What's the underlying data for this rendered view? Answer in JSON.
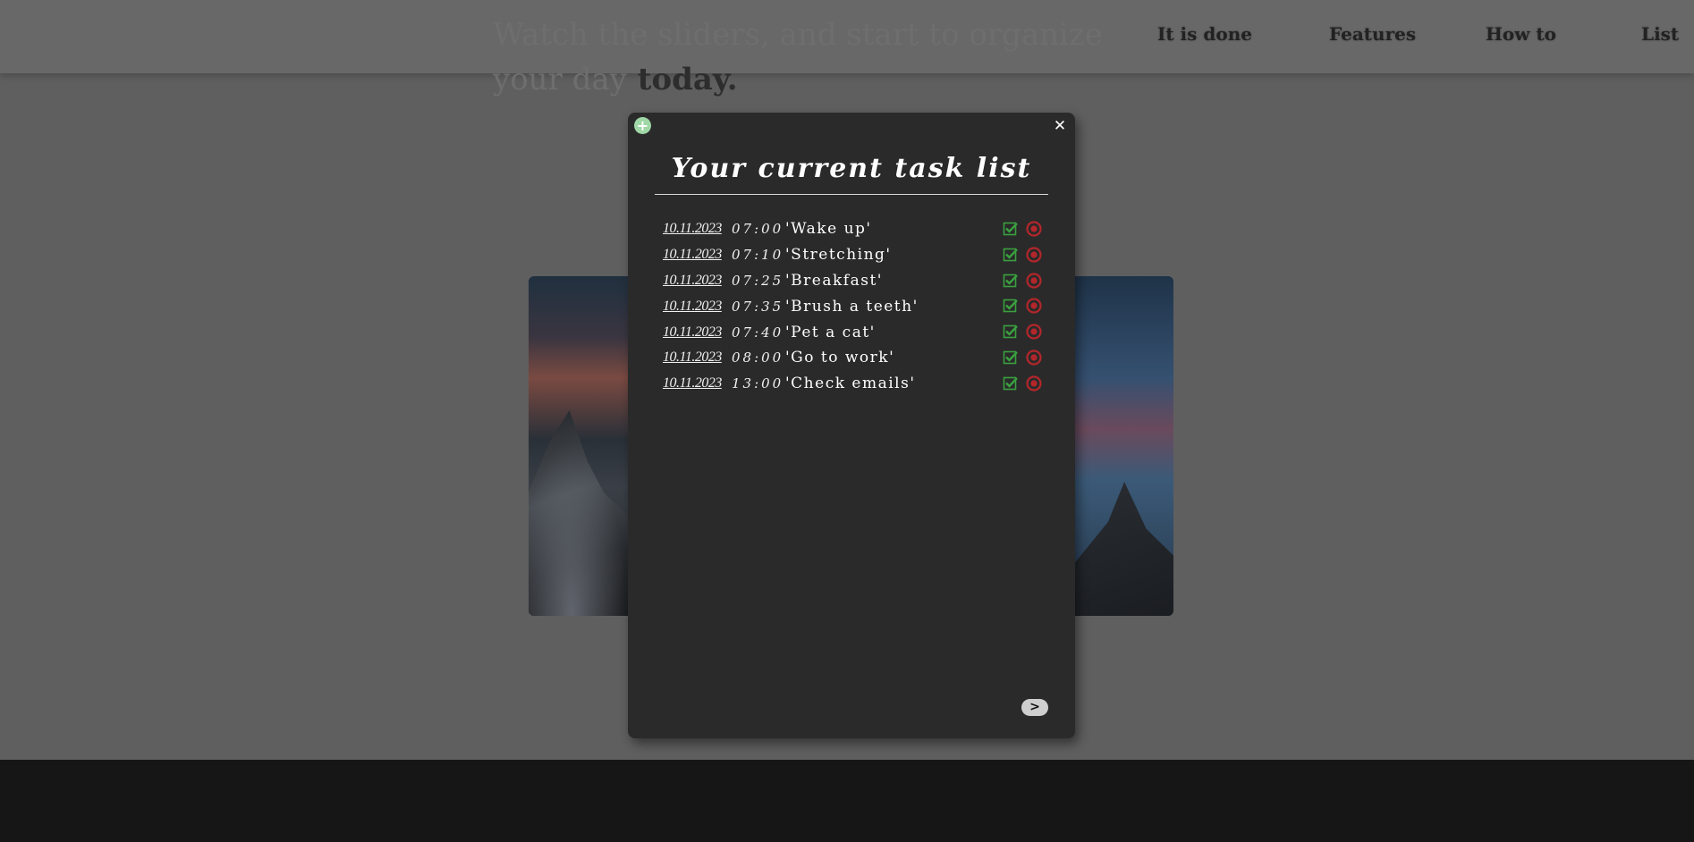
{
  "page": {
    "hero_text_faded": "Watch the sliders, and start to organize your day",
    "hero_text_bold": "today."
  },
  "nav": {
    "items": [
      {
        "label": "It is done"
      },
      {
        "label": "Features"
      },
      {
        "label": "How to"
      },
      {
        "label": "List"
      }
    ]
  },
  "modal": {
    "add_icon": "plus-circle-icon",
    "add_glyph": "+",
    "close_icon": "close-icon",
    "close_glyph": "✕",
    "title": "Your current task list",
    "next_icon": "chevron-right-icon",
    "next_glyph": ">",
    "done_icon": "checkbox-check-icon",
    "delete_icon": "delete-circle-icon",
    "colors": {
      "background": "#2a2a2a",
      "done": "#3aa03f",
      "delete": "#b3262b",
      "add": "#9fd8a6"
    },
    "tasks": [
      {
        "date": "10.11.2023",
        "time": "07:00",
        "name": "'Wake up'"
      },
      {
        "date": "10.11.2023",
        "time": "07:10",
        "name": "'Stretching'"
      },
      {
        "date": "10.11.2023",
        "time": "07:25",
        "name": "'Breakfast'"
      },
      {
        "date": "10.11.2023",
        "time": "07:35",
        "name": "'Brush a teeth'"
      },
      {
        "date": "10.11.2023",
        "time": "07:40",
        "name": "'Pet a cat'"
      },
      {
        "date": "10.11.2023",
        "time": "08:00",
        "name": "'Go to work'"
      },
      {
        "date": "10.11.2023",
        "time": "13:00",
        "name": "'Check emails'"
      }
    ]
  }
}
